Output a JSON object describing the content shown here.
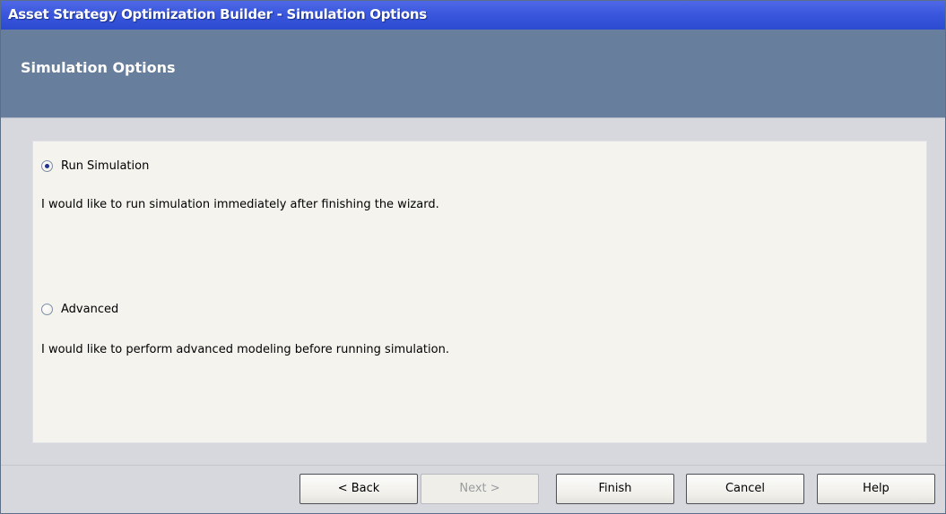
{
  "window": {
    "title": "Asset Strategy Optimization Builder - Simulation Options"
  },
  "header": {
    "title": "Simulation Options"
  },
  "options": [
    {
      "label": "Run Simulation",
      "checked": true,
      "description": "I would like to run simulation immediately after finishing the wizard."
    },
    {
      "label": "Advanced",
      "checked": false,
      "description": "I would like to perform advanced modeling before running simulation."
    }
  ],
  "buttons": {
    "back": "< Back",
    "next": "Next >",
    "finish": "Finish",
    "cancel": "Cancel",
    "help": "Help"
  },
  "colors": {
    "titlebar": "#3a57dd",
    "header_band": "#687e9d",
    "content_bg": "#f4f3ee",
    "window_bg": "#d6d8dd"
  }
}
